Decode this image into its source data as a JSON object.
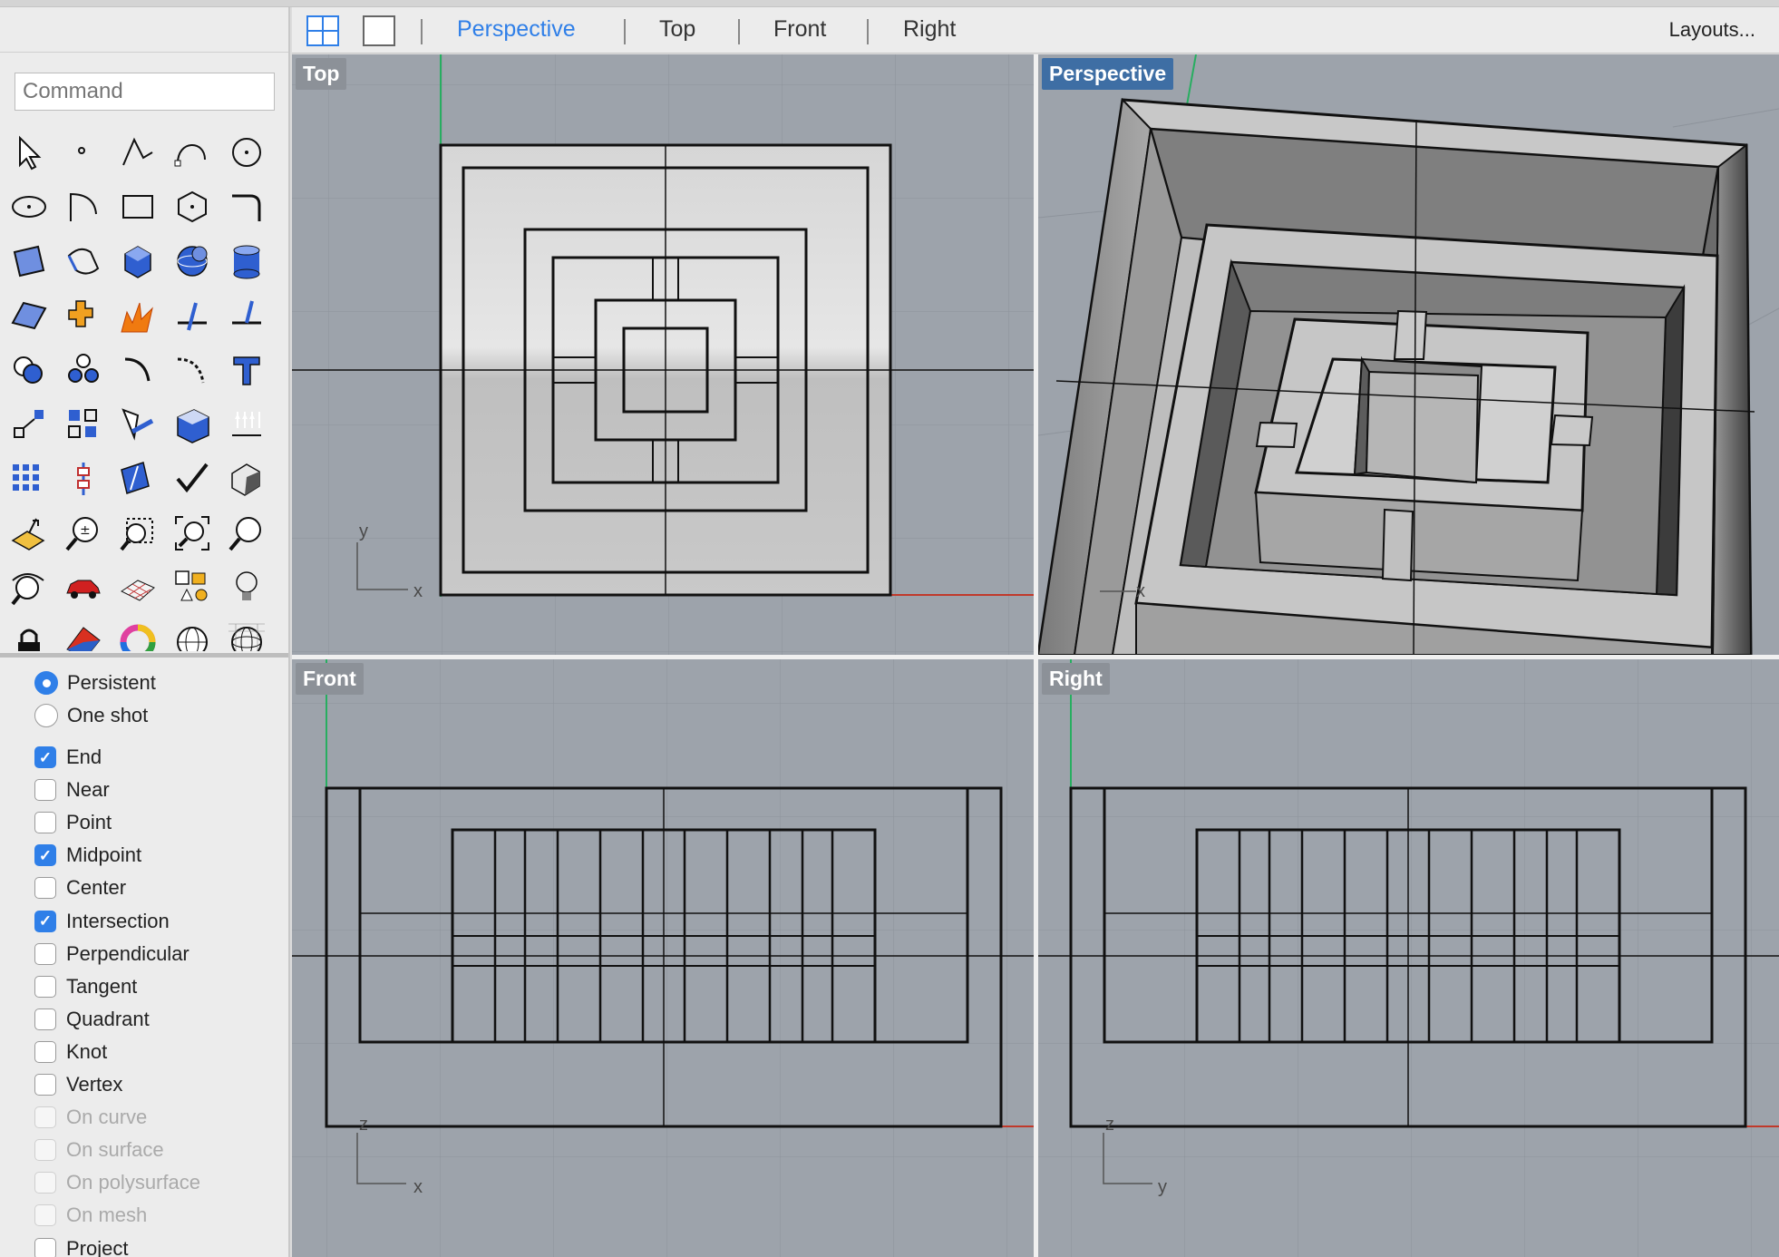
{
  "command": {
    "placeholder": "Command"
  },
  "toolbar": {
    "tabs": [
      {
        "label": "Perspective",
        "active": true
      },
      {
        "label": "Top",
        "active": false
      },
      {
        "label": "Front",
        "active": false
      },
      {
        "label": "Right",
        "active": false
      }
    ],
    "layouts_label": "Layouts..."
  },
  "viewports": {
    "top": {
      "label": "Top",
      "axes": [
        "x",
        "y"
      ]
    },
    "perspective": {
      "label": "Perspective",
      "axes": [
        "x"
      ]
    },
    "front": {
      "label": "Front",
      "axes": [
        "x",
        "z"
      ]
    },
    "right": {
      "label": "Right",
      "axes": [
        "y",
        "z"
      ]
    }
  },
  "tools": [
    "select-arrow-icon",
    "point-icon",
    "polyline-icon",
    "curve-icon",
    "circle-icon",
    "ellipse-icon",
    "arc-icon",
    "rectangle-icon",
    "polygon-icon",
    "fillet-curve-icon",
    "surface-corner-icon",
    "surface-extrude-icon",
    "box-icon",
    "sphere-icon",
    "cylinder-icon",
    "plane-surface-icon",
    "join-icon",
    "explode-icon",
    "trim-icon",
    "split-icon",
    "boolean-union-icon",
    "group-icon",
    "fillet-icon",
    "chamfer-icon",
    "text-icon",
    "scale-icon",
    "array-icon",
    "edit-points-icon",
    "solid-edit-icon",
    "dimension-icon",
    "grid-array-icon",
    "gumball-icon",
    "fin-icon",
    "check-icon",
    "shade-icon",
    "cplane-icon",
    "zoom-in-icon",
    "zoom-window-icon",
    "zoom-extents-icon",
    "zoom-selected-icon",
    "rotate-view-icon",
    "car-icon",
    "mesh-grid-icon",
    "shapes-icon",
    "light-icon",
    "lock-icon",
    "material-icon",
    "color-wheel-icon",
    "wire-sphere-icon",
    "globe-icon"
  ],
  "osnap": {
    "mode": [
      {
        "label": "Persistent",
        "selected": true
      },
      {
        "label": "One shot",
        "selected": false
      }
    ],
    "items": [
      {
        "label": "End",
        "checked": true,
        "enabled": true
      },
      {
        "label": "Near",
        "checked": false,
        "enabled": true
      },
      {
        "label": "Point",
        "checked": false,
        "enabled": true
      },
      {
        "label": "Midpoint",
        "checked": true,
        "enabled": true
      },
      {
        "label": "Center",
        "checked": false,
        "enabled": true
      },
      {
        "label": "Intersection",
        "checked": true,
        "enabled": true
      },
      {
        "label": "Perpendicular",
        "checked": false,
        "enabled": true
      },
      {
        "label": "Tangent",
        "checked": false,
        "enabled": true
      },
      {
        "label": "Quadrant",
        "checked": false,
        "enabled": true
      },
      {
        "label": "Knot",
        "checked": false,
        "enabled": true
      },
      {
        "label": "Vertex",
        "checked": false,
        "enabled": true
      },
      {
        "label": "On curve",
        "checked": false,
        "enabled": false
      },
      {
        "label": "On surface",
        "checked": false,
        "enabled": false
      },
      {
        "label": "On polysurface",
        "checked": false,
        "enabled": false
      },
      {
        "label": "On mesh",
        "checked": false,
        "enabled": false
      },
      {
        "label": "Project",
        "checked": false,
        "enabled": true
      }
    ]
  },
  "colors": {
    "accent": "#2f7fe8",
    "viewport_bg": "#9da3ab",
    "x_axis": "#c0392b",
    "y_axis": "#27ae60",
    "active_label": "#3e6ea4"
  }
}
